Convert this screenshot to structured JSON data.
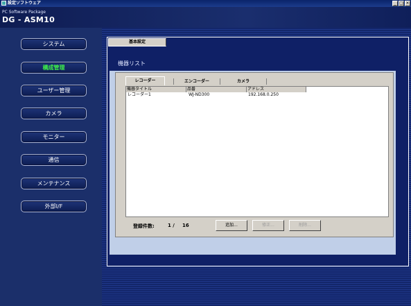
{
  "window": {
    "title": "設定ソフトウェア",
    "buttons": [
      "_",
      "□",
      "×"
    ]
  },
  "header": {
    "subtitle": "PC Software Package",
    "title": "DG - ASM10"
  },
  "sidebar": {
    "items": [
      {
        "label": "システム"
      },
      {
        "label": "構成管理"
      },
      {
        "label": "ユーザー管理"
      },
      {
        "label": "カメラ"
      },
      {
        "label": "モニター"
      },
      {
        "label": "通信"
      },
      {
        "label": "メンテナンス"
      },
      {
        "label": "外部I/F"
      }
    ],
    "active_index": 1
  },
  "panel": {
    "tab_label": "基本設定"
  },
  "device_list": {
    "title": "機器リスト",
    "tabs": [
      "レコーダー",
      "エンコーダー",
      "カメラ"
    ],
    "selected_tab": 0,
    "columns": [
      "機器タイトル",
      "品番",
      "アドレス"
    ],
    "rows": [
      [
        "レコーダー1",
        "WJ-ND300",
        "192.168.0.250"
      ]
    ],
    "count_label": "登録件数:",
    "count": "1 /",
    "count_total": "16",
    "buttons": {
      "add": "追加...",
      "edit": "修正...",
      "delete": "削除..."
    }
  },
  "colors": {
    "active_nav": "#3ef04a",
    "panel_bg": "#0f2066",
    "content_bg": "#c0cfe8"
  }
}
